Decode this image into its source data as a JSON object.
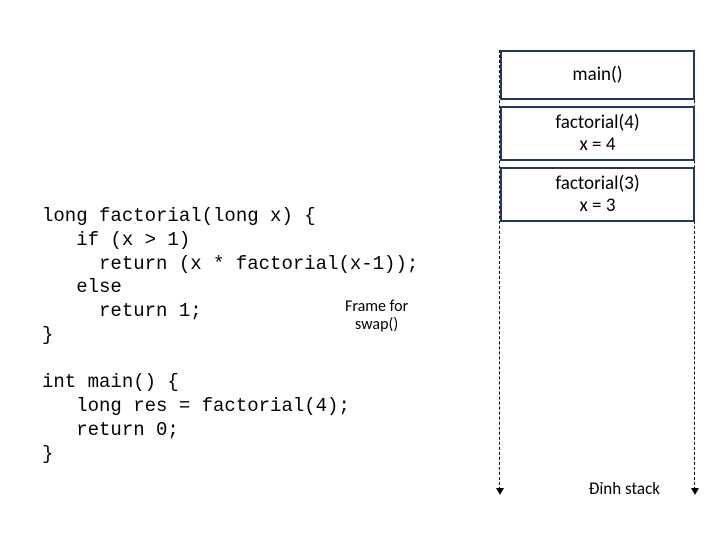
{
  "stack": {
    "frames": [
      {
        "label": "main()"
      },
      {
        "line1": "factorial(4)",
        "line2": "x = 4"
      },
      {
        "line1": "factorial(3)",
        "line2": "x = 3"
      }
    ],
    "bottom_label": "Đỉnh stack"
  },
  "code": {
    "factorial": "long factorial(long x) {\n   if (x > 1)\n     return (x * factorial(x-1));\n   else\n     return 1;\n}",
    "main": "int main() {\n   long res = factorial(4);\n   return 0;\n}"
  },
  "annotation": {
    "line1": "Frame for",
    "line2": "swap()"
  }
}
